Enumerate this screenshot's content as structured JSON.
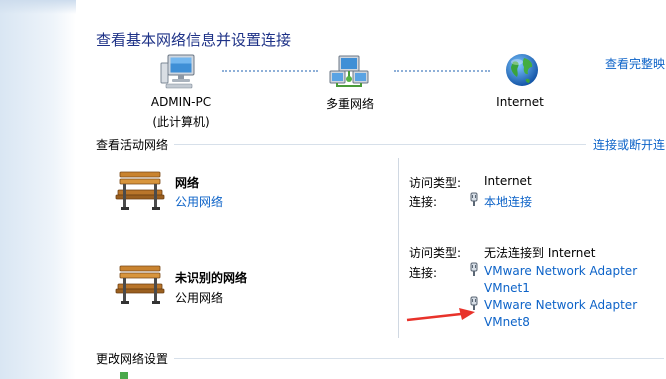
{
  "page": {
    "title": "查看基本网络信息并设置连接",
    "view_full_map_link": "查看完整映"
  },
  "network_map": {
    "computer": {
      "name": "ADMIN-PC",
      "subtitle": "(此计算机)"
    },
    "network": {
      "name": "多重网络"
    },
    "internet": {
      "name": "Internet"
    }
  },
  "active_networks": {
    "header": "查看活动网络",
    "connect_link": "连接或断开连",
    "items": [
      {
        "name": "网络",
        "category": "公用网络",
        "category_is_link": true,
        "access_type_label": "访问类型:",
        "access_type": "Internet",
        "connections_label": "连接:",
        "connections": [
          "本地连接"
        ]
      },
      {
        "name": "未识别的网络",
        "category": "公用网络",
        "category_is_link": false,
        "access_type_label": "访问类型:",
        "access_type": "无法连接到 Internet",
        "connections_label": "连接:",
        "connections": [
          {
            "line1": "VMware Network Adapter",
            "line2": "VMnet1"
          },
          {
            "line1": "VMware Network Adapter",
            "line2": "VMnet8"
          }
        ]
      }
    ]
  },
  "change_settings": {
    "header": "更改网络设置"
  },
  "colors": {
    "title": "#1e3287",
    "link": "#0d63c8",
    "arrow": "#e8322a"
  },
  "icons": [
    "computer-icon",
    "network-icon",
    "globe-icon",
    "bench-icon",
    "plug-icon",
    "arrow-annotation"
  ]
}
